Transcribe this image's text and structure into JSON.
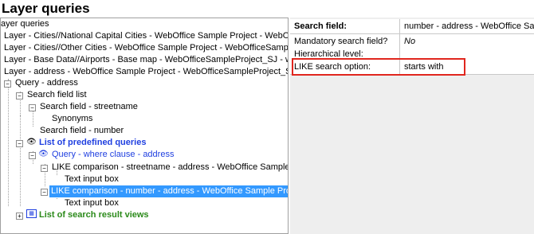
{
  "title": "Layer queries",
  "colors": {
    "selection": "#3399ff",
    "link_blue": "#1f3fe0",
    "result_green": "#2b8a1a",
    "highlight_red": "#e0261e"
  },
  "tree": {
    "root": "ayer queries",
    "layers": [
      "Layer - Cities//National Capital Cities - WebOffice Sample Project - WebOff",
      "Layer - Cities//Other Cities - WebOffice Sample Project - WebOfficeSampl",
      "Layer - Base Data//Airports - Base map - WebOfficeSampleProject_SJ - w-",
      "Layer - address - WebOffice Sample Project - WebOfficeSampleProject_S"
    ],
    "query": "Query - address",
    "search_field_list": "Search field list",
    "search_field_street": "Search field - streetname",
    "synonyms": "Synonyms",
    "search_field_number": "Search field - number",
    "predefined_queries": "List of predefined queries",
    "query_where": "Query - where clause - address",
    "like_street": "LIKE comparison - streetname - address - WebOffice Sample",
    "text_input_1": "Text input box",
    "like_number": "LIKE comparison - number - address - WebOffice Sample Pro",
    "text_input_2": "Text input box",
    "search_result_views": "List of search result views"
  },
  "properties": [
    {
      "name": "Search field:",
      "value": "number - address - WebOffice Sam",
      "name_bold": true,
      "value_italic": false
    },
    {
      "name": "Mandatory search field?",
      "value": "No",
      "name_bold": false,
      "value_italic": true
    },
    {
      "name": "Hierarchical level:",
      "value": "",
      "name_bold": false,
      "value_italic": false
    },
    {
      "name": "LIKE search option:",
      "value": "starts with",
      "name_bold": false,
      "value_italic": false
    }
  ]
}
